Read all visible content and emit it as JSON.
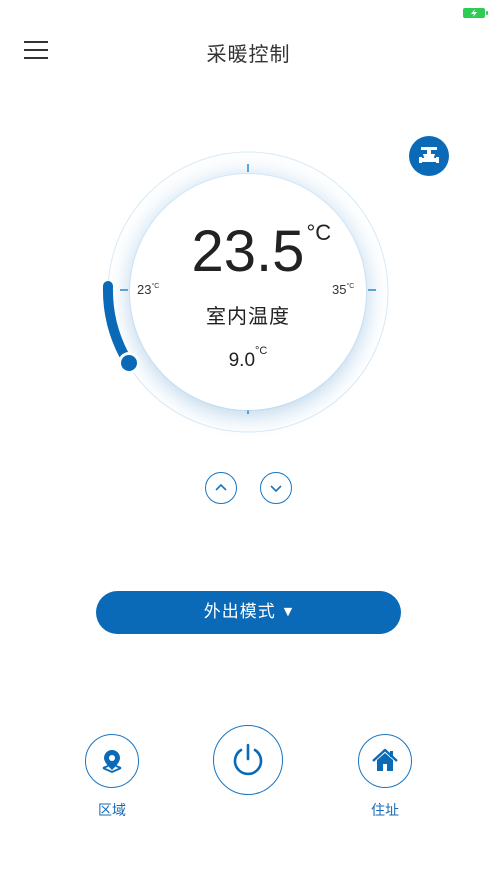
{
  "status_bar": {
    "battery_icon": "battery-charging-icon",
    "battery_color": "#2ecc55"
  },
  "nav": {
    "title": "采暖控制",
    "menu_icon": "hamburger-menu-icon"
  },
  "valve": {
    "icon": "valve-icon",
    "color": "#0a6ab8"
  },
  "dial": {
    "current_temp": "23.5",
    "current_unit": "°C",
    "label": "室内温度",
    "set_temp": "9.0",
    "set_unit": "°C",
    "range_min": "23",
    "range_min_unit": "°C",
    "range_max": "35",
    "range_max_unit": "°C",
    "accent_color": "#0a6ab8"
  },
  "controls": {
    "up_icon": "chevron-up-icon",
    "down_icon": "chevron-down-icon"
  },
  "mode": {
    "label": "外出模式",
    "caret": "▼"
  },
  "bottom": {
    "region_label": "区域",
    "region_icon": "location-pin-icon",
    "power_icon": "power-icon",
    "address_label": "住址",
    "address_icon": "home-icon"
  }
}
